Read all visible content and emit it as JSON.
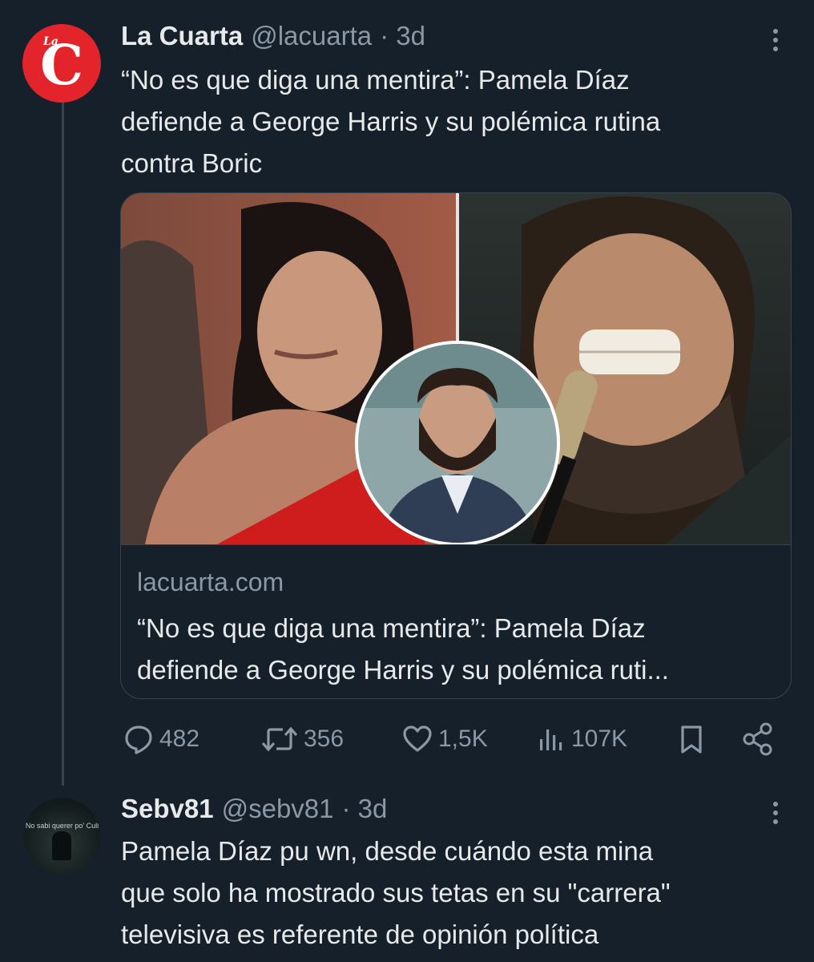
{
  "tweet": {
    "author_name": "La Cuarta",
    "author_handle": "@lacuarta",
    "time": "· 3d",
    "avatar_small": "La",
    "avatar_big": "C",
    "text_lines": [
      "“No es que diga una mentira”: Pamela Díaz",
      "defiende a George Harris y su polémica rutina",
      "contra Boric"
    ],
    "card": {
      "domain": "lacuarta.com",
      "title_lines": [
        "“No es que diga una mentira”: Pamela Díaz",
        "defiende a George Harris y su polémica ruti..."
      ]
    },
    "actions": {
      "replies": "482",
      "retweets": "356",
      "likes": "1,5K",
      "views": "107K"
    },
    "icons": [
      "reply-icon",
      "retweet-icon",
      "like-icon",
      "views-icon",
      "bookmark-icon",
      "share-icon",
      "more-icon"
    ]
  },
  "reply": {
    "author_name": "Sebv81",
    "author_handle": "@sebv81",
    "time": "· 3d",
    "avatar_text": "No sabi querer po' Culi",
    "text_lines": [
      "Pamela Díaz pu wn, desde cuándo esta mina",
      "que solo ha mostrado sus tetas en su \"carrera\"",
      "televisiva es referente de opinión política"
    ]
  },
  "colors": {
    "background": "#15202b",
    "primary_text": "#e7e9ea",
    "secondary_text": "#8b98a5",
    "border": "#38444d",
    "brand_red": "#e3242b"
  }
}
